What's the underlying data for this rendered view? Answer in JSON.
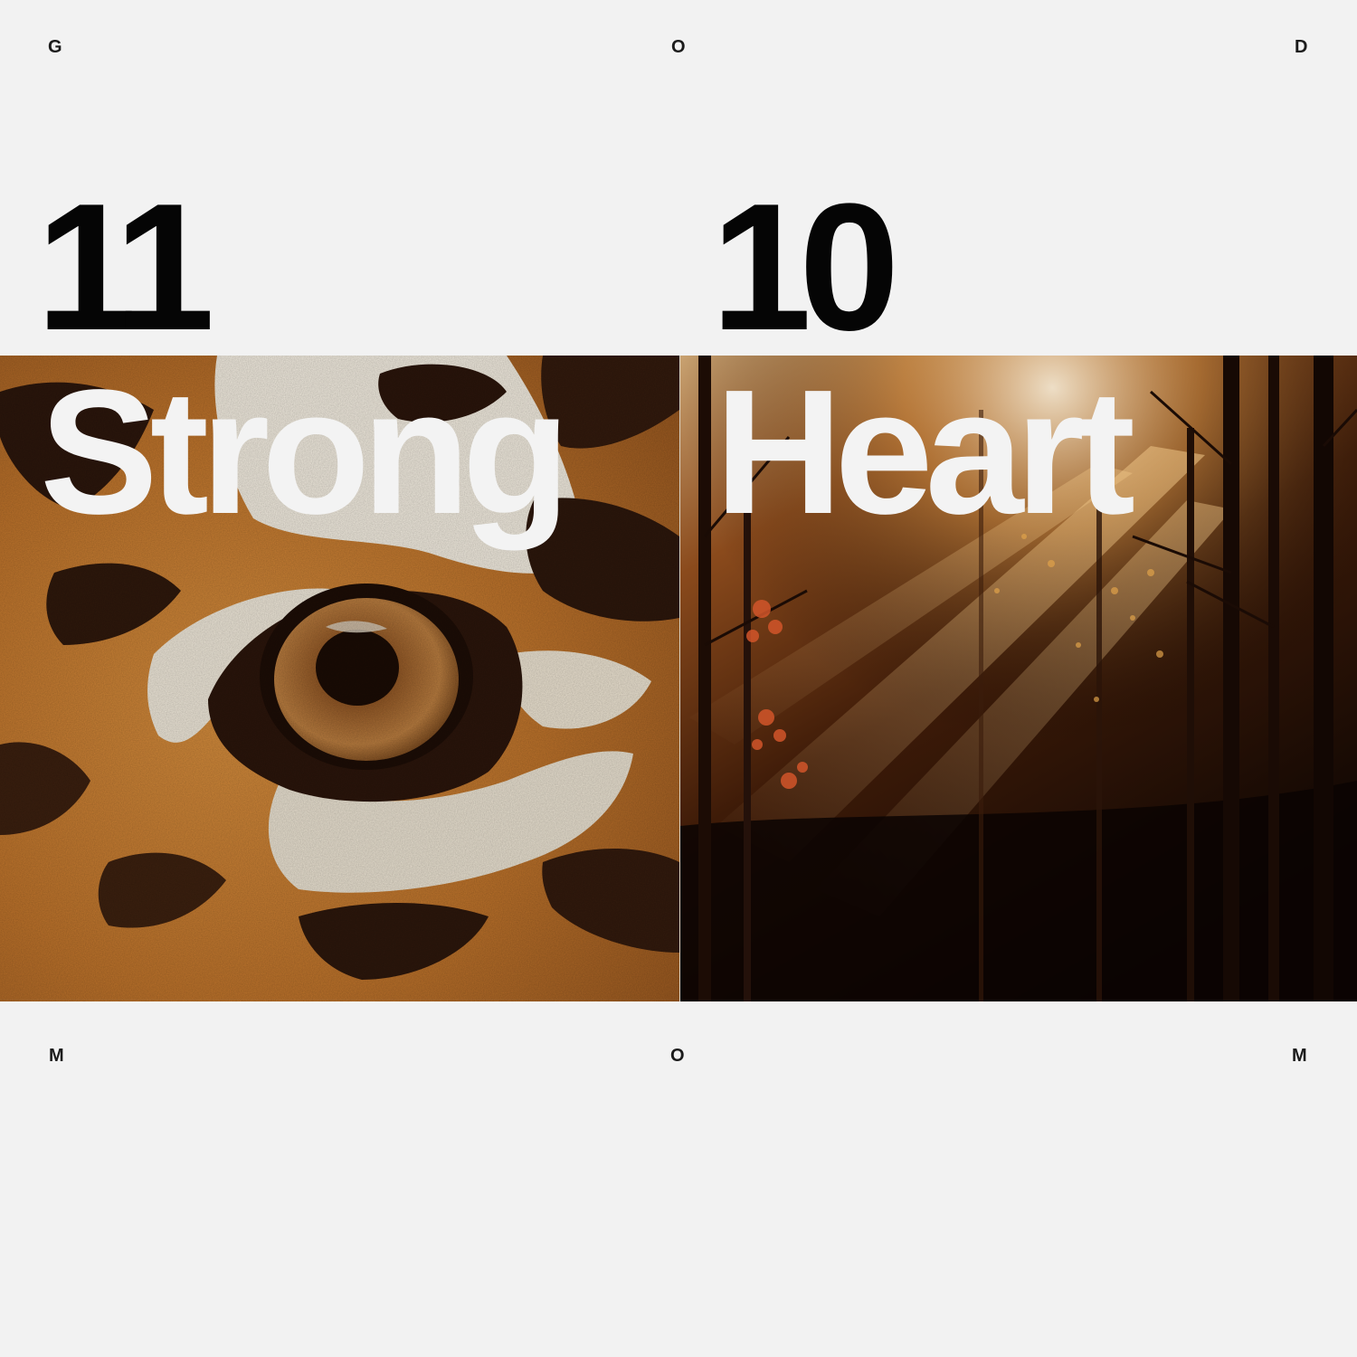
{
  "corners": {
    "top_left": "G",
    "top_center": "O",
    "top_right": "D",
    "bottom_left": "M",
    "bottom_center": "O",
    "bottom_right": "M"
  },
  "panels": [
    {
      "number": "11",
      "word": "Strong",
      "image": "tiger-eye-photo"
    },
    {
      "number": "10",
      "word": "Heart",
      "image": "autumn-forest-sunbeams-photo"
    }
  ],
  "colors": {
    "background": "#f2f2f2",
    "number_text": "#050505",
    "headline_text": "#f3f3f3",
    "tiger_orange": "#c07a2e",
    "forest_dark": "#1a0a04"
  }
}
